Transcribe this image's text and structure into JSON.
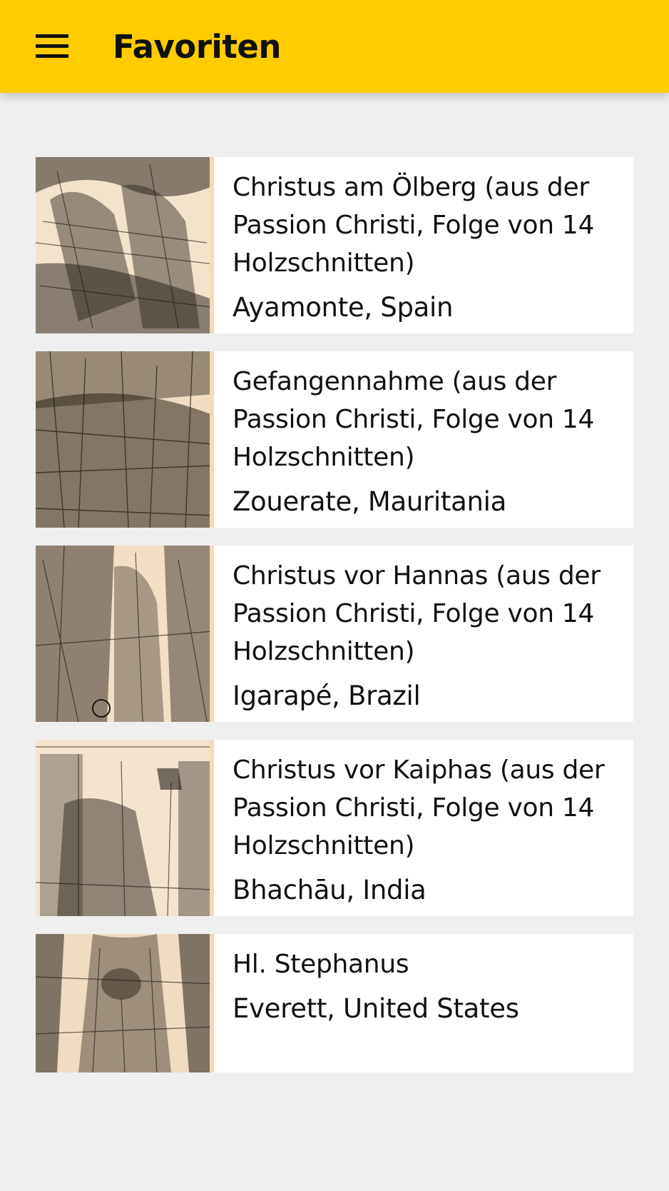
{
  "appbar": {
    "title": "Favoriten",
    "menu_icon": "hamburger-menu-icon",
    "background_color": "#ffcc00"
  },
  "favorites": [
    {
      "title": "Christus am Ölberg (aus der Passion Christi, Folge von 14 Holzschnitten)",
      "location": "Ayamonte, Spain",
      "thumbnail": "woodcut-artwork-image"
    },
    {
      "title": "Gefangennahme (aus der Passion Christi, Folge von 14 Holzschnitten)",
      "location": "Zouerate, Mauritania",
      "thumbnail": "woodcut-artwork-image"
    },
    {
      "title": "Christus vor Hannas (aus der Passion Christi, Folge von 14 Holzschnitten)",
      "location": "Igarapé, Brazil",
      "thumbnail": "woodcut-artwork-image"
    },
    {
      "title": "Christus vor Kaiphas (aus der Passion Christi, Folge von 14 Holzschnitten)",
      "location": "Bhachāu, India",
      "thumbnail": "woodcut-artwork-image"
    },
    {
      "title": "Hl. Stephanus",
      "location": "Everett, United States",
      "thumbnail": "woodcut-artwork-image"
    }
  ]
}
